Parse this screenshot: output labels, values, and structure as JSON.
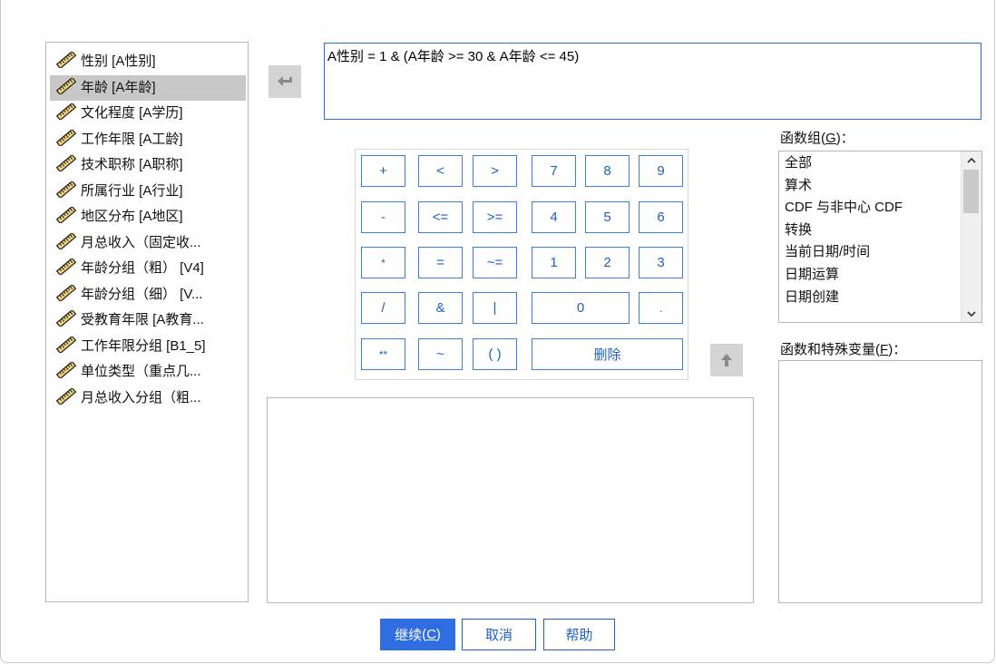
{
  "variables": [
    {
      "label": "性别 [A性别]",
      "selected": false
    },
    {
      "label": "年龄 [A年龄]",
      "selected": true
    },
    {
      "label": "文化程度 [A学历]",
      "selected": false
    },
    {
      "label": "工作年限 [A工龄]",
      "selected": false
    },
    {
      "label": "技术职称 [A职称]",
      "selected": false
    },
    {
      "label": "所属行业 [A行业]",
      "selected": false
    },
    {
      "label": "地区分布 [A地区]",
      "selected": false
    },
    {
      "label": "月总收入（固定收...",
      "selected": false
    },
    {
      "label": "年龄分组（粗） [V4]",
      "selected": false
    },
    {
      "label": "年龄分组（细） [V...",
      "selected": false
    },
    {
      "label": "受教育年限 [A教育...",
      "selected": false
    },
    {
      "label": "工作年限分组 [B1_5]",
      "selected": false
    },
    {
      "label": "单位类型（重点几...",
      "selected": false
    },
    {
      "label": "月总收入分组（粗...",
      "selected": false
    }
  ],
  "expression": "A性别 = 1 & (A年龄 >= 30 & A年龄 <= 45)",
  "keypad": {
    "keys": [
      "+",
      "<",
      ">",
      "7",
      "8",
      "9",
      "-",
      "<=",
      ">=",
      "4",
      "5",
      "6",
      "*",
      "=",
      "~=",
      "1",
      "2",
      "3",
      "/",
      "&",
      "|",
      "0",
      ".",
      "**",
      "~",
      "( )",
      "删除"
    ]
  },
  "function_group": {
    "label": "函数组",
    "mnemonic": "G",
    "suffix": "：",
    "items": [
      "全部",
      "算术",
      "CDF 与非中心 CDF",
      "转换",
      "当前日期/时间",
      "日期运算",
      "日期创建"
    ]
  },
  "functions_vars": {
    "label": "函数和特殊变量",
    "mnemonic": "F",
    "suffix": "："
  },
  "buttons": {
    "continue_label": "继续",
    "continue_mnemonic": "C",
    "cancel_label": "取消",
    "help_label": "帮助"
  },
  "colors": {
    "accent": "#2f6ee0",
    "key_text": "#1f5fc4",
    "selected_row": "#c8c8c8"
  }
}
